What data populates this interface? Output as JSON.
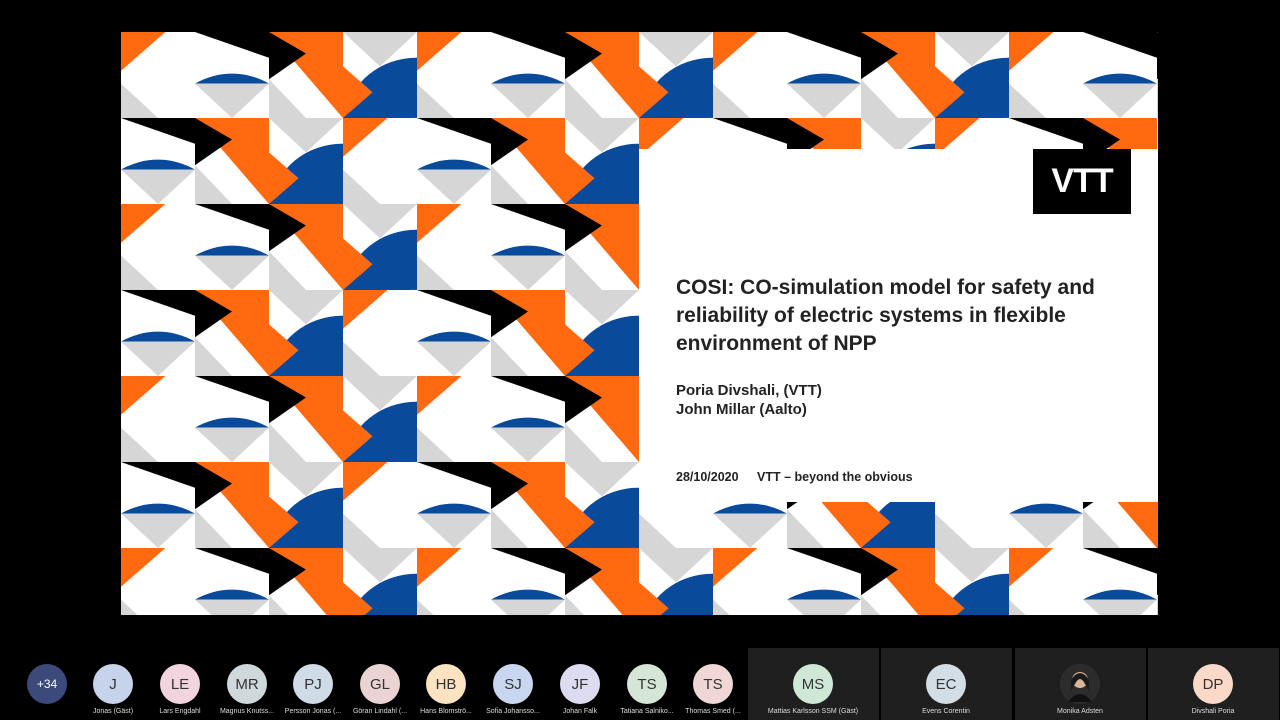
{
  "slide": {
    "logo": "VTT",
    "title": "COSI: CO-simulation model for safety and reliability of electric systems in flexible environment of NPP",
    "authors": [
      "Poria Divshali, (VTT)",
      "John Millar (Aalto)"
    ],
    "date": "28/10/2020",
    "tagline": "VTT – beyond the obvious",
    "colors": {
      "orange": "#ff6a10",
      "blue": "#0a4a9a",
      "gray": "#d6d6d6",
      "black": "#000000",
      "white": "#ffffff"
    }
  },
  "participants": {
    "overflow_count": "+34",
    "people": [
      {
        "initials": "J",
        "name": "Jonas (Gäst)",
        "color": "#c7d3ea"
      },
      {
        "initials": "LE",
        "name": "Lars Engdahl",
        "color": "#f2d4de"
      },
      {
        "initials": "MR",
        "name": "Magnus Knutss...",
        "color": "#cfd8dc"
      },
      {
        "initials": "PJ",
        "name": "Persson Jonas (...",
        "color": "#cfdce8"
      },
      {
        "initials": "GL",
        "name": "Göran Lindahl (...",
        "color": "#ecd3d3"
      },
      {
        "initials": "HB",
        "name": "Hans Blomströ...",
        "color": "#fde3c2"
      },
      {
        "initials": "SJ",
        "name": "Sofia Johansso...",
        "color": "#c9d6f0"
      },
      {
        "initials": "JF",
        "name": "Johan Falk",
        "color": "#dcdcf0"
      },
      {
        "initials": "TS",
        "name": "Tatiana Salniko...",
        "color": "#d6e6d6"
      },
      {
        "initials": "TS",
        "name": "Thomas Smed (...",
        "color": "#f1d6d6"
      },
      {
        "initials": "MS",
        "name": "Mattias Karlsson SSM (Gäst)",
        "color": "#cfe8d6"
      },
      {
        "initials": "EC",
        "name": "Evens Corentin",
        "color": "#d3dde6"
      },
      {
        "initials": "",
        "name": "Monika Adsten",
        "color": "#3a3a3a"
      },
      {
        "initials": "DP",
        "name": "Divshali Poria",
        "color": "#fbd9c8"
      }
    ]
  }
}
